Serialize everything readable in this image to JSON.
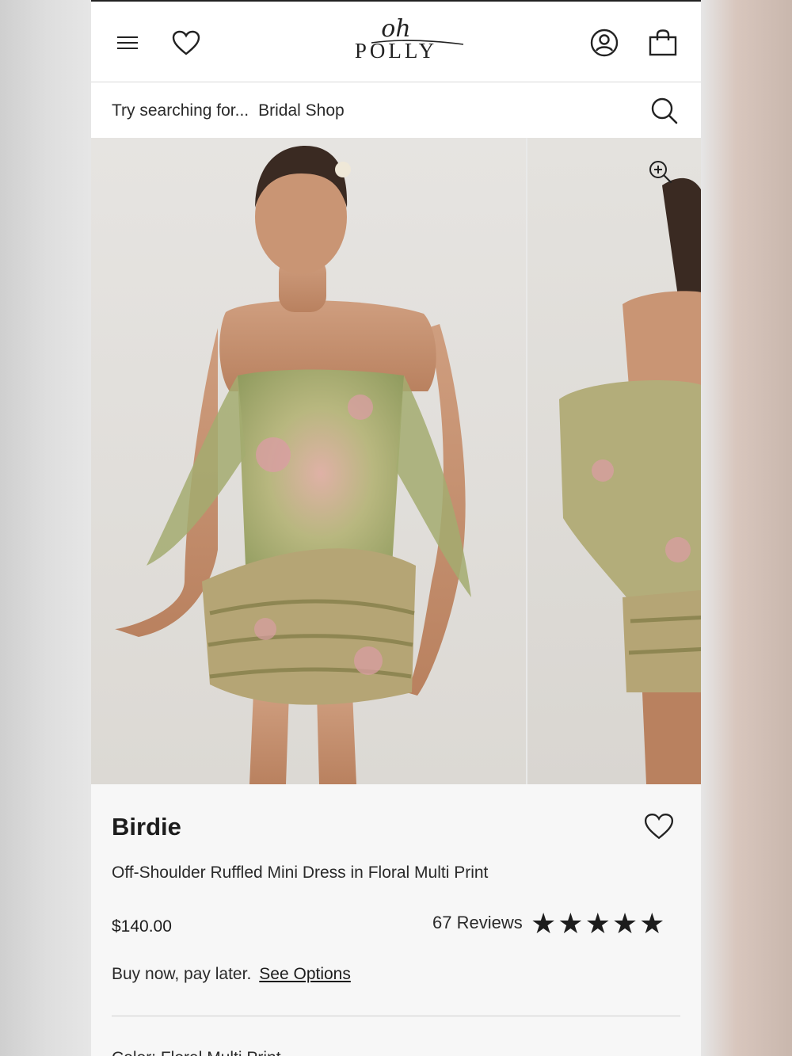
{
  "header": {
    "logo_top": "oh",
    "logo_bottom": "POLLY"
  },
  "search": {
    "prefix": "Try searching for...",
    "suggestion": "Bridal Shop"
  },
  "product": {
    "name": "Birdie",
    "description": "Off-Shoulder Ruffled Mini Dress in Floral Multi Print",
    "price": "$140.00",
    "reviews_label": "67 Reviews",
    "rating": 5,
    "bnpl_text": "Buy now, pay later.",
    "bnpl_link": "See Options",
    "next_section": "Color: Floral Multi Print"
  },
  "colors": {
    "dress_green": "#9aa46a",
    "dress_pink": "#d79aa0",
    "skin": "#c99574"
  }
}
